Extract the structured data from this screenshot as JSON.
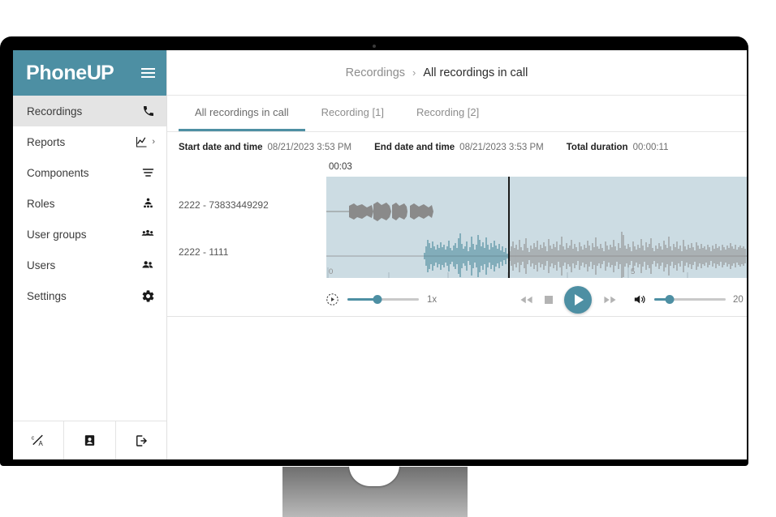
{
  "brand": {
    "name_main": "Phone",
    "name_suffix": "UP",
    "menu_icon": "hamburger-icon",
    "accent_color": "#4d8fa3"
  },
  "sidebar": {
    "items": [
      {
        "label": "Recordings",
        "icon": "phone-icon",
        "active": true,
        "has_chevron": false
      },
      {
        "label": "Reports",
        "icon": "chart-line-icon",
        "active": false,
        "has_chevron": true,
        "chevron": "›"
      },
      {
        "label": "Components",
        "icon": "list-lines-icon",
        "active": false,
        "has_chevron": false
      },
      {
        "label": "Roles",
        "icon": "person-role-icon",
        "active": false,
        "has_chevron": false
      },
      {
        "label": "User groups",
        "icon": "people-group-icon",
        "active": false,
        "has_chevron": false
      },
      {
        "label": "Users",
        "icon": "two-people-icon",
        "active": false,
        "has_chevron": false
      },
      {
        "label": "Settings",
        "icon": "gear-icon",
        "active": false,
        "has_chevron": false
      }
    ],
    "footer_icons": [
      {
        "name": "language-toggle-icon"
      },
      {
        "name": "account-card-icon"
      },
      {
        "name": "logout-icon"
      }
    ]
  },
  "breadcrumb": {
    "parent": "Recordings",
    "separator": "›",
    "current": "All recordings in call"
  },
  "tabs": [
    {
      "label": "All recordings in call",
      "active": true
    },
    {
      "label": "Recording [1]",
      "active": false
    },
    {
      "label": "Recording [2]",
      "active": false
    }
  ],
  "meta": {
    "start_label": "Start date and time",
    "start_value": "08/21/2023 3:53 PM",
    "end_label": "End date and time",
    "end_value": "08/21/2023 3:53 PM",
    "duration_label": "Total duration",
    "duration_value": "00:00:11"
  },
  "player": {
    "cursor_time": "00:03",
    "tracks": [
      {
        "label": "2222 - 73833449292"
      },
      {
        "label": "2222 - 1111"
      }
    ],
    "ruler": {
      "zero": "0",
      "five": "5"
    },
    "waveform_bg": "#ccdce3",
    "waveform_played_color": "#4d8fa3",
    "waveform_unplayed_color": "#8a8a8a",
    "speed": {
      "icon": "playback-speed-icon",
      "value_label": "1x",
      "fill_percent": 42
    },
    "transport": {
      "rewind_icon": "rewind-icon",
      "stop_icon": "stop-icon",
      "play_icon": "play-icon",
      "forward_icon": "fast-forward-icon"
    },
    "volume": {
      "icon": "volume-icon",
      "value_label": "20",
      "fill_percent": 22
    }
  }
}
